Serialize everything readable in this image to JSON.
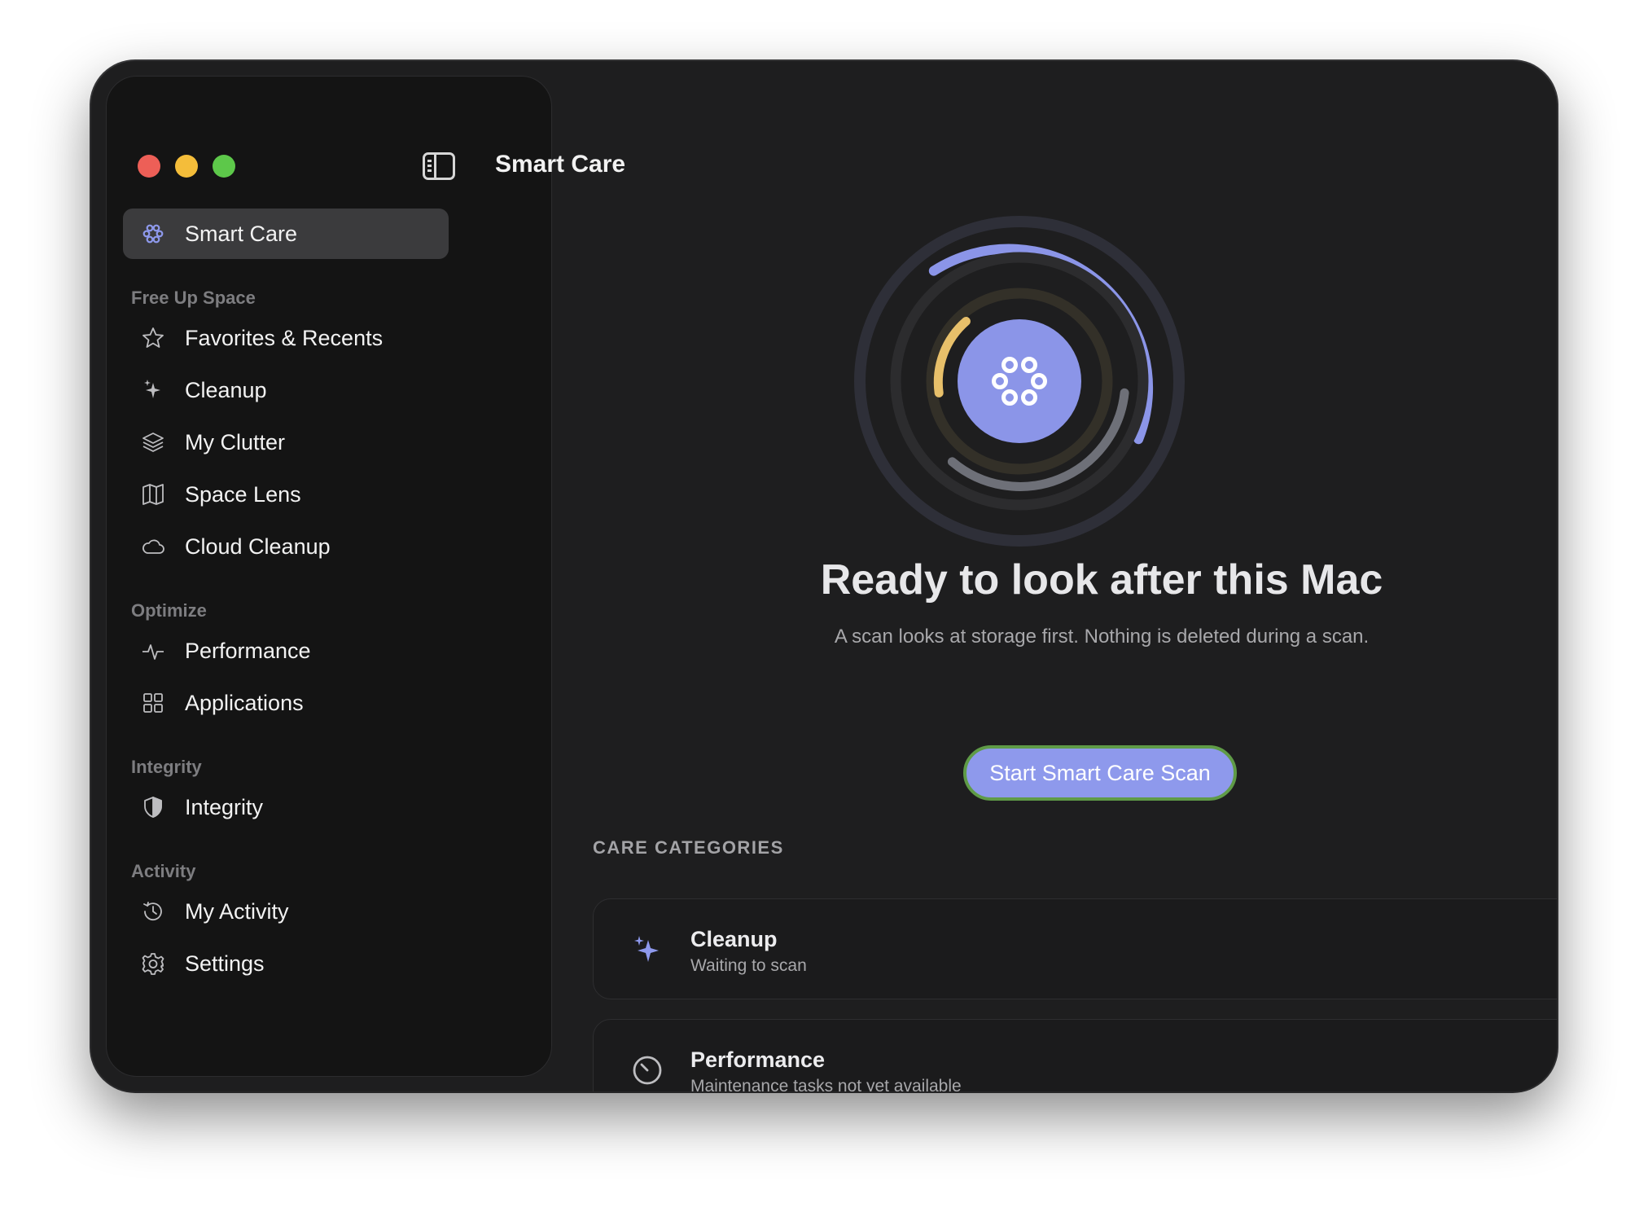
{
  "window": {
    "title": "Smart Care"
  },
  "sidebar": {
    "active_item": {
      "label": "Smart Care",
      "icon": "smart-care-icon"
    },
    "sections": [
      {
        "label": "Free Up Space",
        "items": [
          {
            "label": "Favorites & Recents",
            "icon": "star-icon"
          },
          {
            "label": "Cleanup",
            "icon": "sparkle-icon"
          },
          {
            "label": "My Clutter",
            "icon": "layers-icon"
          },
          {
            "label": "Space Lens",
            "icon": "map-icon"
          },
          {
            "label": "Cloud Cleanup",
            "icon": "cloud-icon"
          }
        ]
      },
      {
        "label": "Optimize",
        "items": [
          {
            "label": "Performance",
            "icon": "pulse-icon"
          },
          {
            "label": "Applications",
            "icon": "grid-icon"
          }
        ]
      },
      {
        "label": "Integrity",
        "items": [
          {
            "label": "Integrity",
            "icon": "shield-icon"
          }
        ]
      },
      {
        "label": "Activity",
        "items": [
          {
            "label": "My Activity",
            "icon": "history-icon"
          },
          {
            "label": "Settings",
            "icon": "gear-icon"
          }
        ]
      }
    ]
  },
  "main": {
    "headline": "Ready to look after this Mac",
    "subline": "A scan looks at storage first. Nothing is deleted during a scan.",
    "scan_button": "Start Smart Care Scan",
    "categories_label": "CARE CATEGORIES",
    "categories": [
      {
        "title": "Cleanup",
        "subtitle": "Waiting to scan",
        "icon": "sparkle-icon"
      },
      {
        "title": "Performance",
        "subtitle": "Maintenance tasks not yet available",
        "icon": "gauge-icon",
        "status_icon": "minus-circle-icon"
      }
    ]
  },
  "colors": {
    "accent": "#8e99ec",
    "ring_outer": "#8b95e8",
    "ring_middle": "#6e7078",
    "ring_inner": "#e8c06a",
    "button_border": "#5f9b47",
    "window_bg": "#1e1e1f",
    "sidebar_bg": "#141414"
  }
}
